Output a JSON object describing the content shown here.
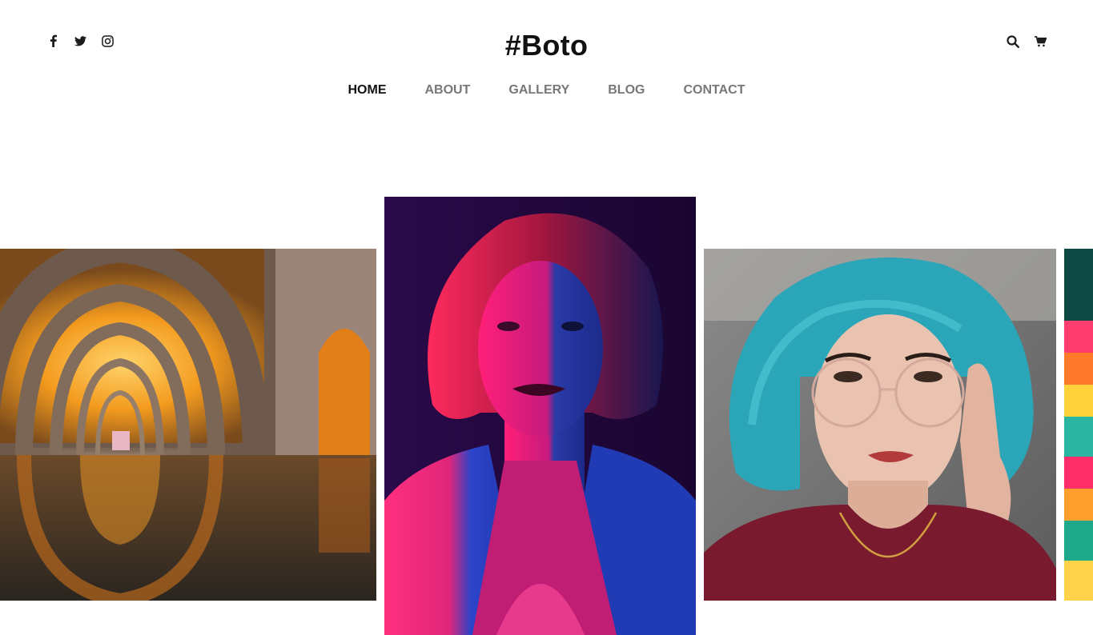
{
  "brand": {
    "logo_text": "#Boto"
  },
  "social": [
    {
      "name": "facebook-icon"
    },
    {
      "name": "twitter-icon"
    },
    {
      "name": "instagram-icon"
    }
  ],
  "tools": [
    {
      "name": "search-icon"
    },
    {
      "name": "cart-icon"
    }
  ],
  "nav": {
    "items": [
      {
        "label": "HOME",
        "active": true
      },
      {
        "label": "ABOUT",
        "active": false
      },
      {
        "label": "GALLERY",
        "active": false
      },
      {
        "label": "BLOG",
        "active": false
      },
      {
        "label": "CONTACT",
        "active": false
      }
    ],
    "accent_color": "#7cb342"
  },
  "gallery": {
    "slides": [
      {
        "subject": "illuminated-arched-corridor-photo"
      },
      {
        "subject": "neon-lit-portrait-photo"
      },
      {
        "subject": "blue-haired-woman-glasses-photo"
      },
      {
        "subject": "colorful-abstract-photo"
      }
    ]
  }
}
